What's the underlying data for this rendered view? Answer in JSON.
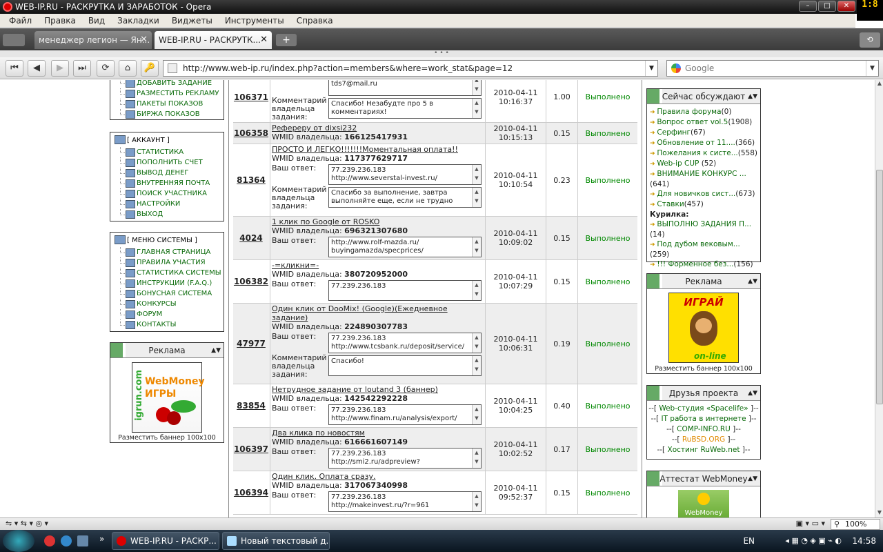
{
  "window": {
    "title": "WEB-IP.RU - РАСКРУТКА И ЗАРАБОТОК - Opera",
    "clock_badge": "1:8"
  },
  "menu": [
    "Файл",
    "Правка",
    "Вид",
    "Закладки",
    "Виджеты",
    "Инструменты",
    "Справка"
  ],
  "tabs": [
    {
      "label": "менеджер легион — Ян..."
    },
    {
      "label": "WEB-IP.RU - РАСКРУТК..."
    }
  ],
  "address": {
    "url": "http://www.web-ip.ru/index.php?action=members&where=work_stat&page=12"
  },
  "search": {
    "placeholder": "Google"
  },
  "left": {
    "top_items": [
      "ДОБАВИТЬ ЗАДАНИЕ",
      "РАЗМЕСТИТЬ РЕКЛАМУ",
      "ПАКЕТЫ ПОКАЗОВ",
      "БИРЖА ПОКАЗОВ"
    ],
    "account": {
      "title": "[ АККАУНТ ]",
      "items": [
        "СТАТИСТИКА",
        "ПОПОЛНИТЬ СЧЕТ",
        "ВЫВОД ДЕНЕГ",
        "ВНУТРЕННЯЯ ПОЧТА",
        "ПОИСК УЧАСТНИКА",
        "НАСТРОЙКИ",
        "ВЫХОД"
      ]
    },
    "system": {
      "title": "[ МЕНЮ СИСТЕМЫ ]",
      "items": [
        "ГЛАВНАЯ СТРАНИЦА",
        "ПРАВИЛА УЧАСТИЯ",
        "СТАТИСТИКА СИСТЕМЫ",
        "ИНСТРУКЦИИ (F.A.Q.)",
        "БОНУСНАЯ СИСТЕМА",
        "КОНКУРСЫ",
        "ФОРУМ",
        "КОНТАКТЫ"
      ]
    },
    "ad": {
      "title": "Реклама",
      "banner_text": "WebMoney ИГРЫ",
      "banner_side": "igrun.com",
      "caption": "Разместить баннер 100x100"
    }
  },
  "rows": [
    {
      "id": "106371",
      "title": "",
      "wmid_label": "",
      "wmid": "",
      "answer_label": "",
      "answer": [
        "tds7@mail.ru"
      ],
      "comment_label": "Комментарий владельца задания:",
      "comment": [
        "Спасибо! Незабудте про 5 в",
        "комментариях!"
      ],
      "date": "2010-04-11",
      "time": "10:16:37",
      "amount": "1.00",
      "status": "Выполнено"
    },
    {
      "id": "106358",
      "title": "Рефереру от dixsi232",
      "wmid_label": "WMID владельца:",
      "wmid": "166125417931",
      "date": "2010-04-11",
      "time": "10:15:13",
      "amount": "0.15",
      "status": "Выполнено"
    },
    {
      "id": "81364",
      "title": "ПРОСТО И ЛЕГКО!!!!!!!Моментальная оплата!!",
      "wmid_label": "WMID владельца:",
      "wmid": "117377629717",
      "answer_label": "Ваш ответ:",
      "answer": [
        "77.239.236.183",
        "http://www.severstal-invest.ru/"
      ],
      "comment_label": "Комментарий владельца задания:",
      "comment": [
        "Спасибо за выполнение, завтра",
        "выполняйте еще, если не трудно"
      ],
      "date": "2010-04-11",
      "time": "10:10:54",
      "amount": "0.23",
      "status": "Выполнено"
    },
    {
      "id": "4024",
      "title": "1 клик по Google от ROSKO",
      "wmid_label": "WMID владельца:",
      "wmid": "696321307680",
      "answer_label": "Ваш ответ:",
      "answer": [
        "http://www.rolf-mazda.ru/",
        "buyingamazda/specprices/"
      ],
      "date": "2010-04-11",
      "time": "10:09:02",
      "amount": "0.15",
      "status": "Выполнено"
    },
    {
      "id": "106382",
      "title": "-=кликни=-",
      "wmid_label": "WMID владельца:",
      "wmid": "380720952000",
      "answer_label": "Ваш ответ:",
      "answer": [
        "77.239.236.183"
      ],
      "date": "2010-04-11",
      "time": "10:07:29",
      "amount": "0.15",
      "status": "Выполнено"
    },
    {
      "id": "47977",
      "title": "Один клик от DooMix! (Google)(Ежедневное задание)",
      "wmid_label": "WMID владельца:",
      "wmid": "224890307783",
      "answer_label": "Ваш ответ:",
      "answer": [
        "77.239.236.183",
        "http://www.tcsbank.ru/deposit/service/"
      ],
      "comment_label": "Комментарий владельца задания:",
      "comment": [
        "Спасибо!"
      ],
      "date": "2010-04-11",
      "time": "10:06:31",
      "amount": "0.19",
      "status": "Выполнено"
    },
    {
      "id": "83854",
      "title": "Нетрудное задание от loutand 3 (баннер)",
      "wmid_label": "WMID владельца:",
      "wmid": "142542292228",
      "answer_label": "Ваш ответ:",
      "answer": [
        "77.239.236.183",
        "http://www.finam.ru/analysis/export/"
      ],
      "date": "2010-04-11",
      "time": "10:04:25",
      "amount": "0.40",
      "status": "Выполнено"
    },
    {
      "id": "106397",
      "title": "Два клика по новостям",
      "wmid_label": "WMID владельца:",
      "wmid": "616661607149",
      "answer_label": "Ваш ответ:",
      "answer": [
        "77.239.236.183",
        "http://smi2.ru/adpreview?"
      ],
      "date": "2010-04-11",
      "time": "10:02:52",
      "amount": "0.17",
      "status": "Выполнено"
    },
    {
      "id": "106394",
      "title": "Один клик. Оплата сразу.",
      "wmid_label": "WMID владельца:",
      "wmid": "317067340998",
      "answer_label": "Ваш ответ:",
      "answer": [
        "77.239.236.183",
        "http://makeinvest.ru/?r=961"
      ],
      "date": "2010-04-11",
      "time": "09:52:37",
      "amount": "0.15",
      "status": "Выполнено"
    }
  ],
  "right": {
    "discuss": {
      "title": "Сейчас обсуждают",
      "items": [
        {
          "t": "Правила форума",
          "c": "(0)"
        },
        {
          "t": "Вопрос ответ vol.5",
          "c": "(1908)"
        },
        {
          "t": "Серфинг",
          "c": "(67)"
        },
        {
          "t": "Обновление от 11....",
          "c": "(366)"
        },
        {
          "t": "Пожелания к систе...",
          "c": "(558)"
        },
        {
          "t": "Web-ip CUP",
          "c": "(52)"
        },
        {
          "t": "ВНИМАНИЕ КОНКУРС ...",
          "c": "(641)"
        },
        {
          "t": "Для новичков сист...",
          "c": "(673)"
        },
        {
          "t": "Ставки",
          "c": "(457)"
        }
      ],
      "sub_title": "Курилка:",
      "sub_items": [
        {
          "t": "ВЫПОЛНЮ ЗАДАНИЯ П...",
          "c": "(14)"
        },
        {
          "t": "Под дубом вековым...",
          "c": "(259)"
        },
        {
          "t": "!!! Форменное без...",
          "c": "(156)"
        }
      ]
    },
    "ad": {
      "title": "Реклама",
      "banner_top": "ИГРАЙ",
      "banner_bottom": "on-line",
      "caption": "Разместить баннер 100x100"
    },
    "friends": {
      "title": "Друзья проекта",
      "items": [
        "Web-студия «Spacelife»",
        "IT работа в интернете",
        "COMP-INFO.RU",
        "RuBSD.ORG",
        "Хостинг RuWeb.net"
      ]
    },
    "attest": {
      "title": "Аттестат WebMoney",
      "badge": "WebMoney"
    }
  },
  "statusbar": {
    "zoom": "100%"
  },
  "taskbar": {
    "items": [
      "WEB-IP.RU - РАСКР...",
      "Новый текстовый д..."
    ],
    "lang": "EN",
    "time": "14:58"
  }
}
